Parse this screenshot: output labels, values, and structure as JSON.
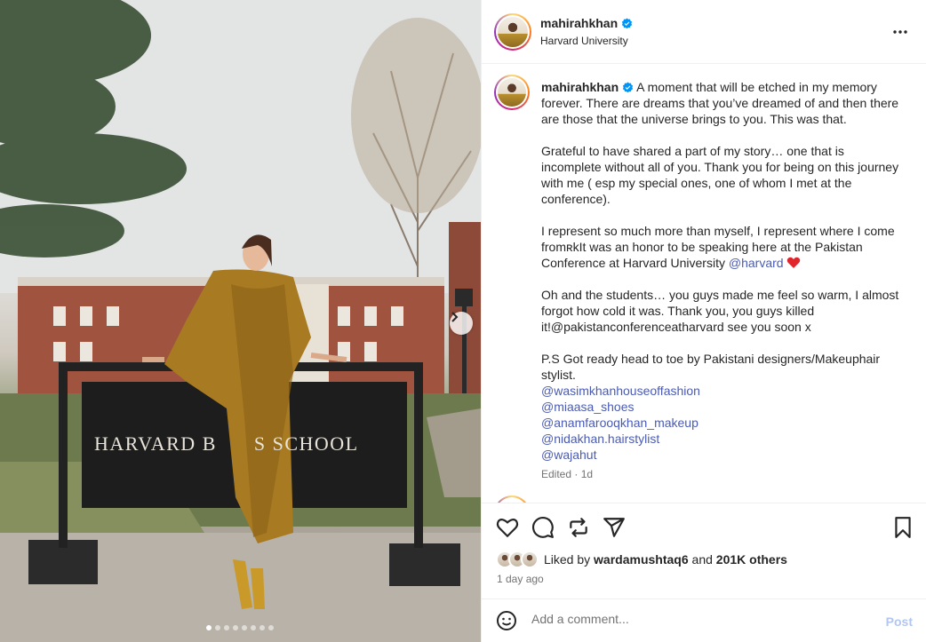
{
  "photo": {
    "sign_text": "HARVARD B      S SCHOOL",
    "dots_total": 8,
    "dots_active_index": 0,
    "next_icon": "chevron-right-icon"
  },
  "header": {
    "username": "mahirahkhan",
    "verified_icon": "verified-badge-icon",
    "location": "Harvard University",
    "more_icon": "more-options-icon"
  },
  "caption": {
    "username": "mahirahkhan",
    "first_paragraph": "A moment that will be etched in my memory forever. There are dreams that you’ve dreamed of and then there are those that the universe brings to you. This was that.",
    "second_paragraph": "Grateful to have shared a part of my story… one that is incomplete without all of you. Thank you for being on this journey with me ( esp my special ones, one of whom I met at the conference).",
    "third_paragraph": "I represent so much more than myself, I represent where I come fromʀkIt was an honor to be speaking here at the Pakistan Conference at Harvard University",
    "third_mention": "@harvard",
    "heart_icon": "red-heart-emoji",
    "fourth_paragraph": "Oh and the students… you guys made me feel so warm, I almost forgot how cold it was. Thank you, you guys killed it!@pakistanconferenceatharvard see you soon x",
    "fifth_paragraph": "P.S Got ready head to toe by Pakistani designers/Makeuphair stylist.",
    "mentions": [
      "@wasimkhanhouseoffashion",
      "@miaasa_shoes",
      "@anamfarooqkhan_makeup",
      "@nidakhan.hairstylist",
      "@wajahut"
    ],
    "edited": "Edited · 1d"
  },
  "actions": {
    "like_icon": "heart-icon",
    "comment_icon": "comment-icon",
    "share_icon": "repost-icon",
    "send_icon": "send-icon",
    "save_icon": "bookmark-icon"
  },
  "likes": {
    "prefix": "Liked by",
    "user": "wardamushtaq6",
    "connector": "and",
    "count": "201K others"
  },
  "time_ago": "1 day ago",
  "comment": {
    "emoji_icon": "emoji-icon",
    "placeholder": "Add a comment...",
    "post_label": "Post"
  },
  "colors": {
    "mention": "#4a5bb5",
    "post_disabled": "#b2c6f0",
    "verified": "#0095f6",
    "muted": "#737373"
  }
}
